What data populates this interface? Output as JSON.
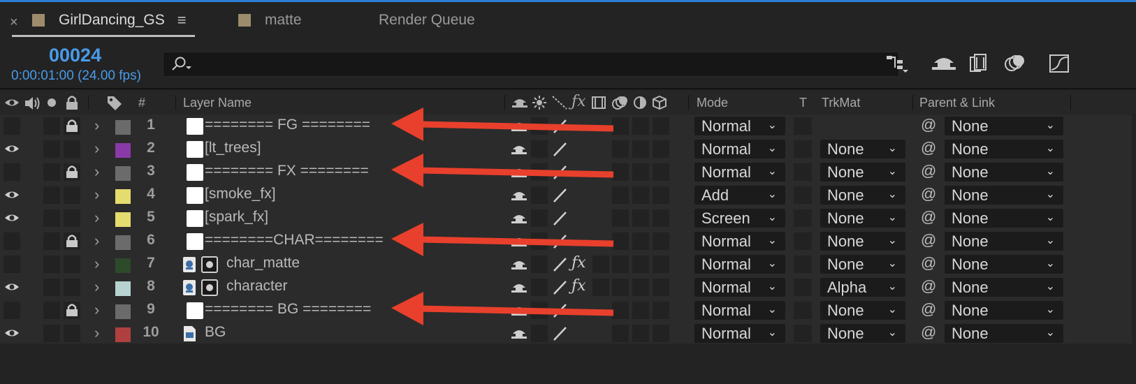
{
  "tabs": [
    {
      "label": "GirlDancing_GS",
      "active": true,
      "swatch": "#9d8c6c"
    },
    {
      "label": "matte",
      "active": false,
      "swatch": "#9d8c6c"
    },
    {
      "label": "Render Queue",
      "active": false
    }
  ],
  "tab_close": "×",
  "tab_menu": "≡",
  "timecode": "00024",
  "time_sub": "0:00:01:00 (24.00 fps)",
  "search": {
    "placeholder": ""
  },
  "columns": {
    "hash": "#",
    "layer_name": "Layer Name",
    "mode": "Mode",
    "t": "T",
    "trkmat": "TrkMat",
    "parent_link": "Parent & Link"
  },
  "layers": [
    {
      "num": "1",
      "name": "======== FG ========",
      "color": "#6b6b6b",
      "visible": false,
      "locked": true,
      "mode": "Normal",
      "trkmat": "",
      "parent": "None",
      "type": "solid",
      "fx": false,
      "annotated": true
    },
    {
      "num": "2",
      "name": "[lt_trees]",
      "color": "#8a3aa6",
      "visible": true,
      "locked": false,
      "mode": "Normal",
      "trkmat": "None",
      "parent": "None",
      "type": "solid",
      "fx": false,
      "annotated": false
    },
    {
      "num": "3",
      "name": "======== FX ========",
      "color": "#6b6b6b",
      "visible": false,
      "locked": true,
      "mode": "Normal",
      "trkmat": "None",
      "parent": "None",
      "type": "solid",
      "fx": false,
      "annotated": true
    },
    {
      "num": "4",
      "name": "[smoke_fx]",
      "color": "#e4dc6e",
      "visible": true,
      "locked": false,
      "mode": "Add",
      "trkmat": "None",
      "parent": "None",
      "type": "solid",
      "fx": false,
      "annotated": false
    },
    {
      "num": "5",
      "name": "[spark_fx]",
      "color": "#e4dc6e",
      "visible": true,
      "locked": false,
      "mode": "Screen",
      "trkmat": "None",
      "parent": "None",
      "type": "solid",
      "fx": false,
      "annotated": false
    },
    {
      "num": "6",
      "name": "========CHAR========",
      "color": "#6b6b6b",
      "visible": false,
      "locked": true,
      "mode": "Normal",
      "trkmat": "None",
      "parent": "None",
      "type": "solid",
      "fx": false,
      "annotated": true
    },
    {
      "num": "7",
      "name": "char_matte",
      "color": "#2d4a2a",
      "visible": false,
      "locked": false,
      "mode": "Normal",
      "trkmat": "None",
      "parent": "None",
      "type": "precomp",
      "fx": true,
      "annotated": false
    },
    {
      "num": "8",
      "name": "character",
      "color": "#b6d3d0",
      "visible": true,
      "locked": false,
      "mode": "Normal",
      "trkmat": "Alpha",
      "parent": "None",
      "type": "precomp",
      "fx": true,
      "annotated": false
    },
    {
      "num": "9",
      "name": "======== BG ========",
      "color": "#6b6b6b",
      "visible": false,
      "locked": true,
      "mode": "Normal",
      "trkmat": "None",
      "parent": "None",
      "type": "solid",
      "fx": false,
      "annotated": true
    },
    {
      "num": "10",
      "name": "BG",
      "color": "#b04040",
      "visible": true,
      "locked": false,
      "mode": "Normal",
      "trkmat": "None",
      "parent": "None",
      "type": "footage",
      "fx": false,
      "annotated": false
    }
  ],
  "accent_color": "#4a9bea",
  "annotation_color": "#e8402c"
}
